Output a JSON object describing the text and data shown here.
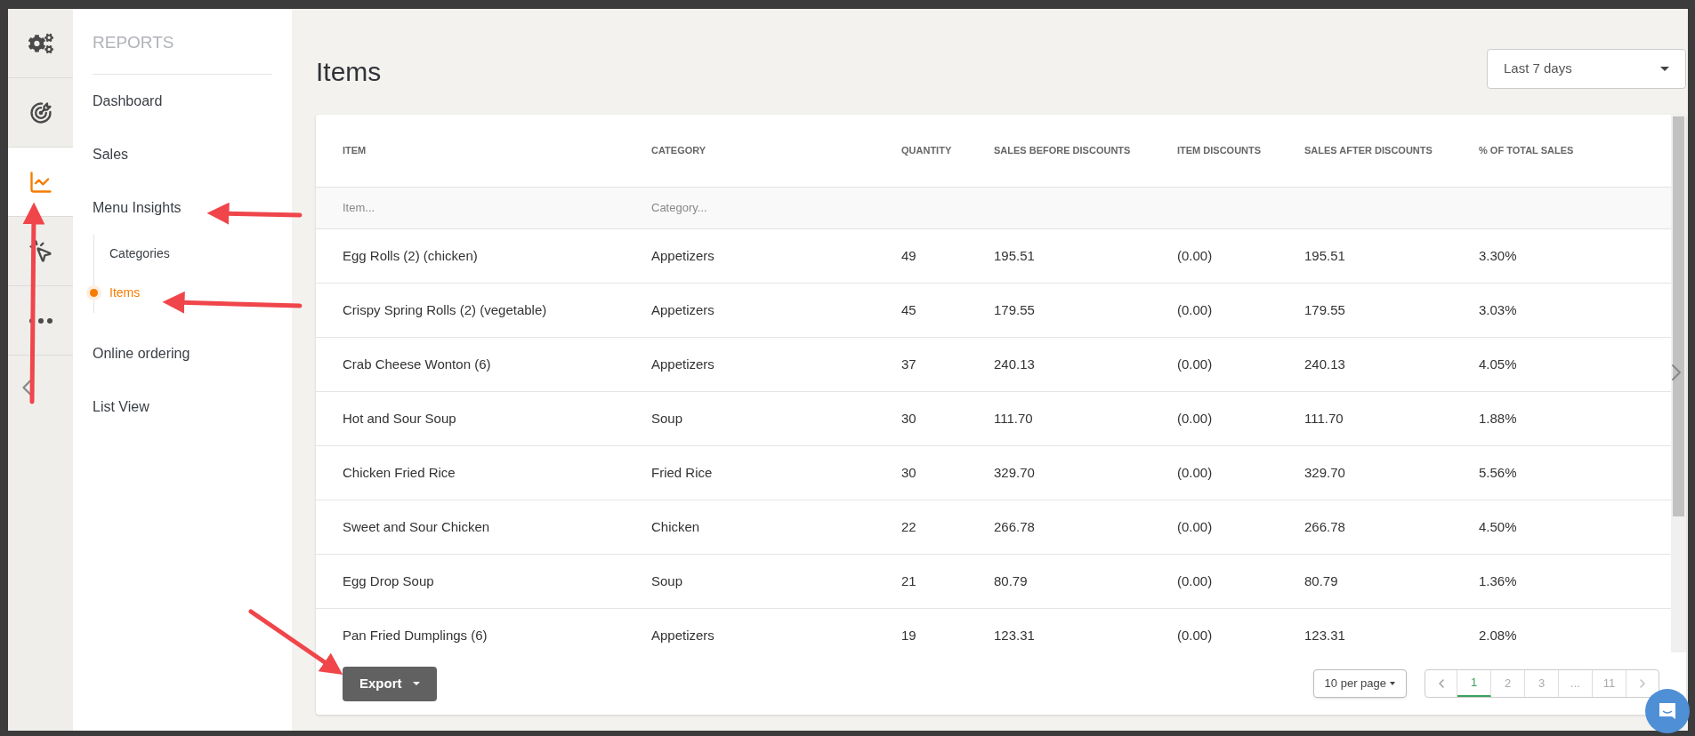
{
  "rail": [
    {
      "kind": "gears",
      "selected": false
    },
    {
      "kind": "target",
      "selected": false
    },
    {
      "kind": "chart",
      "selected": true
    },
    {
      "kind": "click",
      "selected": false
    },
    {
      "kind": "more",
      "selected": false
    }
  ],
  "nav": {
    "heading": "REPORTS",
    "items": [
      {
        "label": "Dashboard"
      },
      {
        "label": "Sales"
      },
      {
        "label": "Menu Insights",
        "children": [
          {
            "label": "Categories",
            "selected": false
          },
          {
            "label": "Items",
            "selected": true
          }
        ]
      },
      {
        "label": "Online ordering"
      },
      {
        "label": "List View"
      }
    ]
  },
  "page": {
    "title": "Items",
    "range": "Last 7 days"
  },
  "table": {
    "columns": [
      "ITEM",
      "CATEGORY",
      "QUANTITY",
      "SALES BEFORE DISCOUNTS",
      "ITEM DISCOUNTS",
      "SALES AFTER DISCOUNTS",
      "% OF TOTAL SALES"
    ],
    "filters": [
      {
        "placeholder": "Item..."
      },
      {
        "placeholder": "Category..."
      }
    ],
    "rows": [
      [
        "Egg Rolls (2) (chicken)",
        "Appetizers",
        "49",
        "195.51",
        "(0.00)",
        "195.51",
        "3.30%"
      ],
      [
        "Crispy Spring Rolls (2) (vegetable)",
        "Appetizers",
        "45",
        "179.55",
        "(0.00)",
        "179.55",
        "3.03%"
      ],
      [
        "Crab Cheese Wonton (6)",
        "Appetizers",
        "37",
        "240.13",
        "(0.00)",
        "240.13",
        "4.05%"
      ],
      [
        "Hot and Sour Soup",
        "Soup",
        "30",
        "111.70",
        "(0.00)",
        "111.70",
        "1.88%"
      ],
      [
        "Chicken Fried Rice",
        "Fried Rice",
        "30",
        "329.70",
        "(0.00)",
        "329.70",
        "5.56%"
      ],
      [
        "Sweet and Sour Chicken",
        "Chicken",
        "22",
        "266.78",
        "(0.00)",
        "266.78",
        "4.50%"
      ],
      [
        "Egg Drop Soup",
        "Soup",
        "21",
        "80.79",
        "(0.00)",
        "80.79",
        "1.36%"
      ],
      [
        "Pan Fried Dumplings (6)",
        "Appetizers",
        "19",
        "123.31",
        "(0.00)",
        "123.31",
        "2.08%"
      ]
    ]
  },
  "footer": {
    "export": "Export",
    "per_page": "10 per page",
    "pages": [
      {
        "label": "1",
        "selected": true
      },
      {
        "label": "2",
        "selected": false
      },
      {
        "label": "3",
        "selected": false
      },
      {
        "label": "...",
        "selected": false
      },
      {
        "label": "11",
        "selected": false
      }
    ]
  }
}
